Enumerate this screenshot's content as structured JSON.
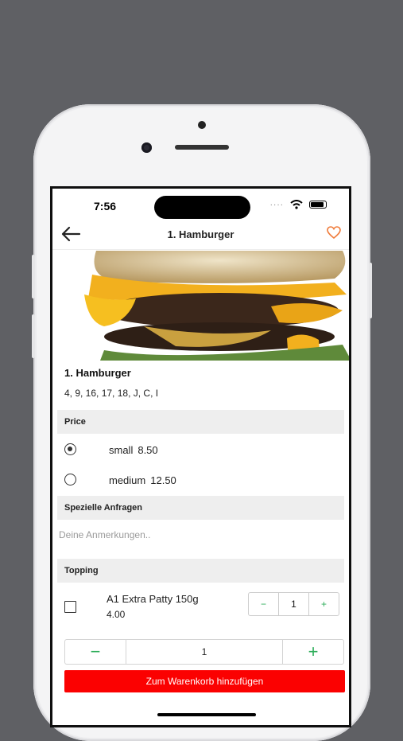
{
  "status_bar": {
    "time": "7:56",
    "signal": "····"
  },
  "nav": {
    "title": "1. Hamburger"
  },
  "product": {
    "name": "1. Hamburger",
    "allergens": "4, 9, 16, 17, 18, J, C, I"
  },
  "price_section": {
    "heading": "Price",
    "options": [
      {
        "label": "small",
        "price": "8.50",
        "selected": true
      },
      {
        "label": "medium",
        "price": "12.50",
        "selected": false
      }
    ]
  },
  "requests_section": {
    "heading": "Spezielle Anfragen",
    "placeholder": "Deine Anmerkungen.."
  },
  "topping_section": {
    "heading": "Topping",
    "items": [
      {
        "name": "A1 Extra Patty 150g",
        "price": "4.00",
        "quantity": "1",
        "minus": "−",
        "plus": "+"
      }
    ]
  },
  "quantity": {
    "value": "1",
    "minus": "−",
    "plus": "+"
  },
  "add_to_cart_label": "Zum Warenkorb hinzufügen",
  "colors": {
    "accent_green": "#2fae5b",
    "cart_red": "#fb0101",
    "heart_orange": "#f07b3a"
  },
  "icons": {
    "back": "arrow-left-icon",
    "favorite": "heart-outline-icon",
    "wifi": "wifi-icon",
    "battery": "battery-icon"
  }
}
